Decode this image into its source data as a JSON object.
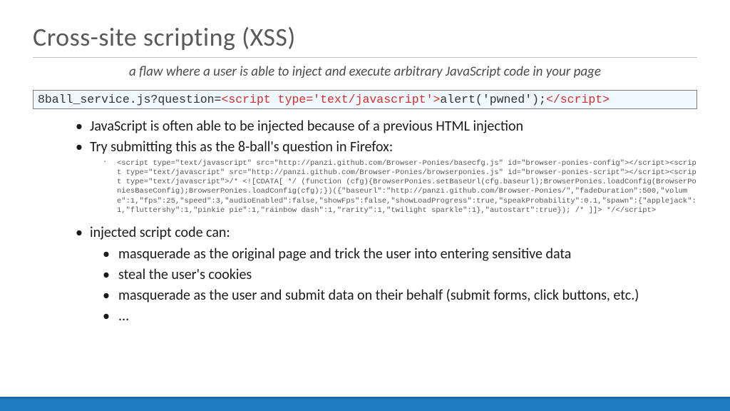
{
  "title": "Cross-site scripting (XSS)",
  "subtitle": "a flaw where a user is able to inject and execute arbitrary JavaScript code in your page",
  "code_banner": {
    "prefix": "8ball_service.js?question=",
    "open_tag": "<script type='text/javascript'>",
    "body": "alert('pwned');",
    "close_tag": "</script>"
  },
  "bullets": {
    "b1": "JavaScript is often able to be injected because of a previous HTML injection",
    "b2": "Try submitting this as the 8-ball's question in Firefox:",
    "code_block": "<script type=\"text/javascript\" src=\"http://panzi.github.com/Browser-Ponies/basecfg.js\" id=\"browser-ponies-config\"></script><script type=\"text/javascript\" src=\"http://panzi.github.com/Browser-Ponies/browserponies.js\" id=\"browser-ponies-script\"></script><script type=\"text/javascript\">/* <![CDATA[ */ (function (cfg){BrowserPonies.setBaseUrl(cfg.baseurl);BrowserPonies.loadConfig(BrowserPoniesBaseConfig);BrowserPonies.loadConfig(cfg);})({\"baseurl\":\"http://panzi.github.com/Browser-Ponies/\",\"fadeDuration\":500,\"volume\":1,\"fps\":25,\"speed\":3,\"audioEnabled\":false,\"showFps\":false,\"showLoadProgress\":true,\"speakProbability\":0.1,\"spawn\":{\"applejack\":1,\"fluttershy\":1,\"pinkie pie\":1,\"rainbow dash\":1,\"rarity\":1,\"twilight sparkle\":1},\"autostart\":true}); /* ]]> */</script>",
    "b3": "injected script code can:",
    "inner": {
      "i1": "masquerade as the original page and trick the user into entering sensitive data",
      "i2": "steal the user's cookies",
      "i3": "masquerade as the user and submit data on their behalf (submit forms, click buttons, etc.)",
      "i4": "..."
    }
  }
}
